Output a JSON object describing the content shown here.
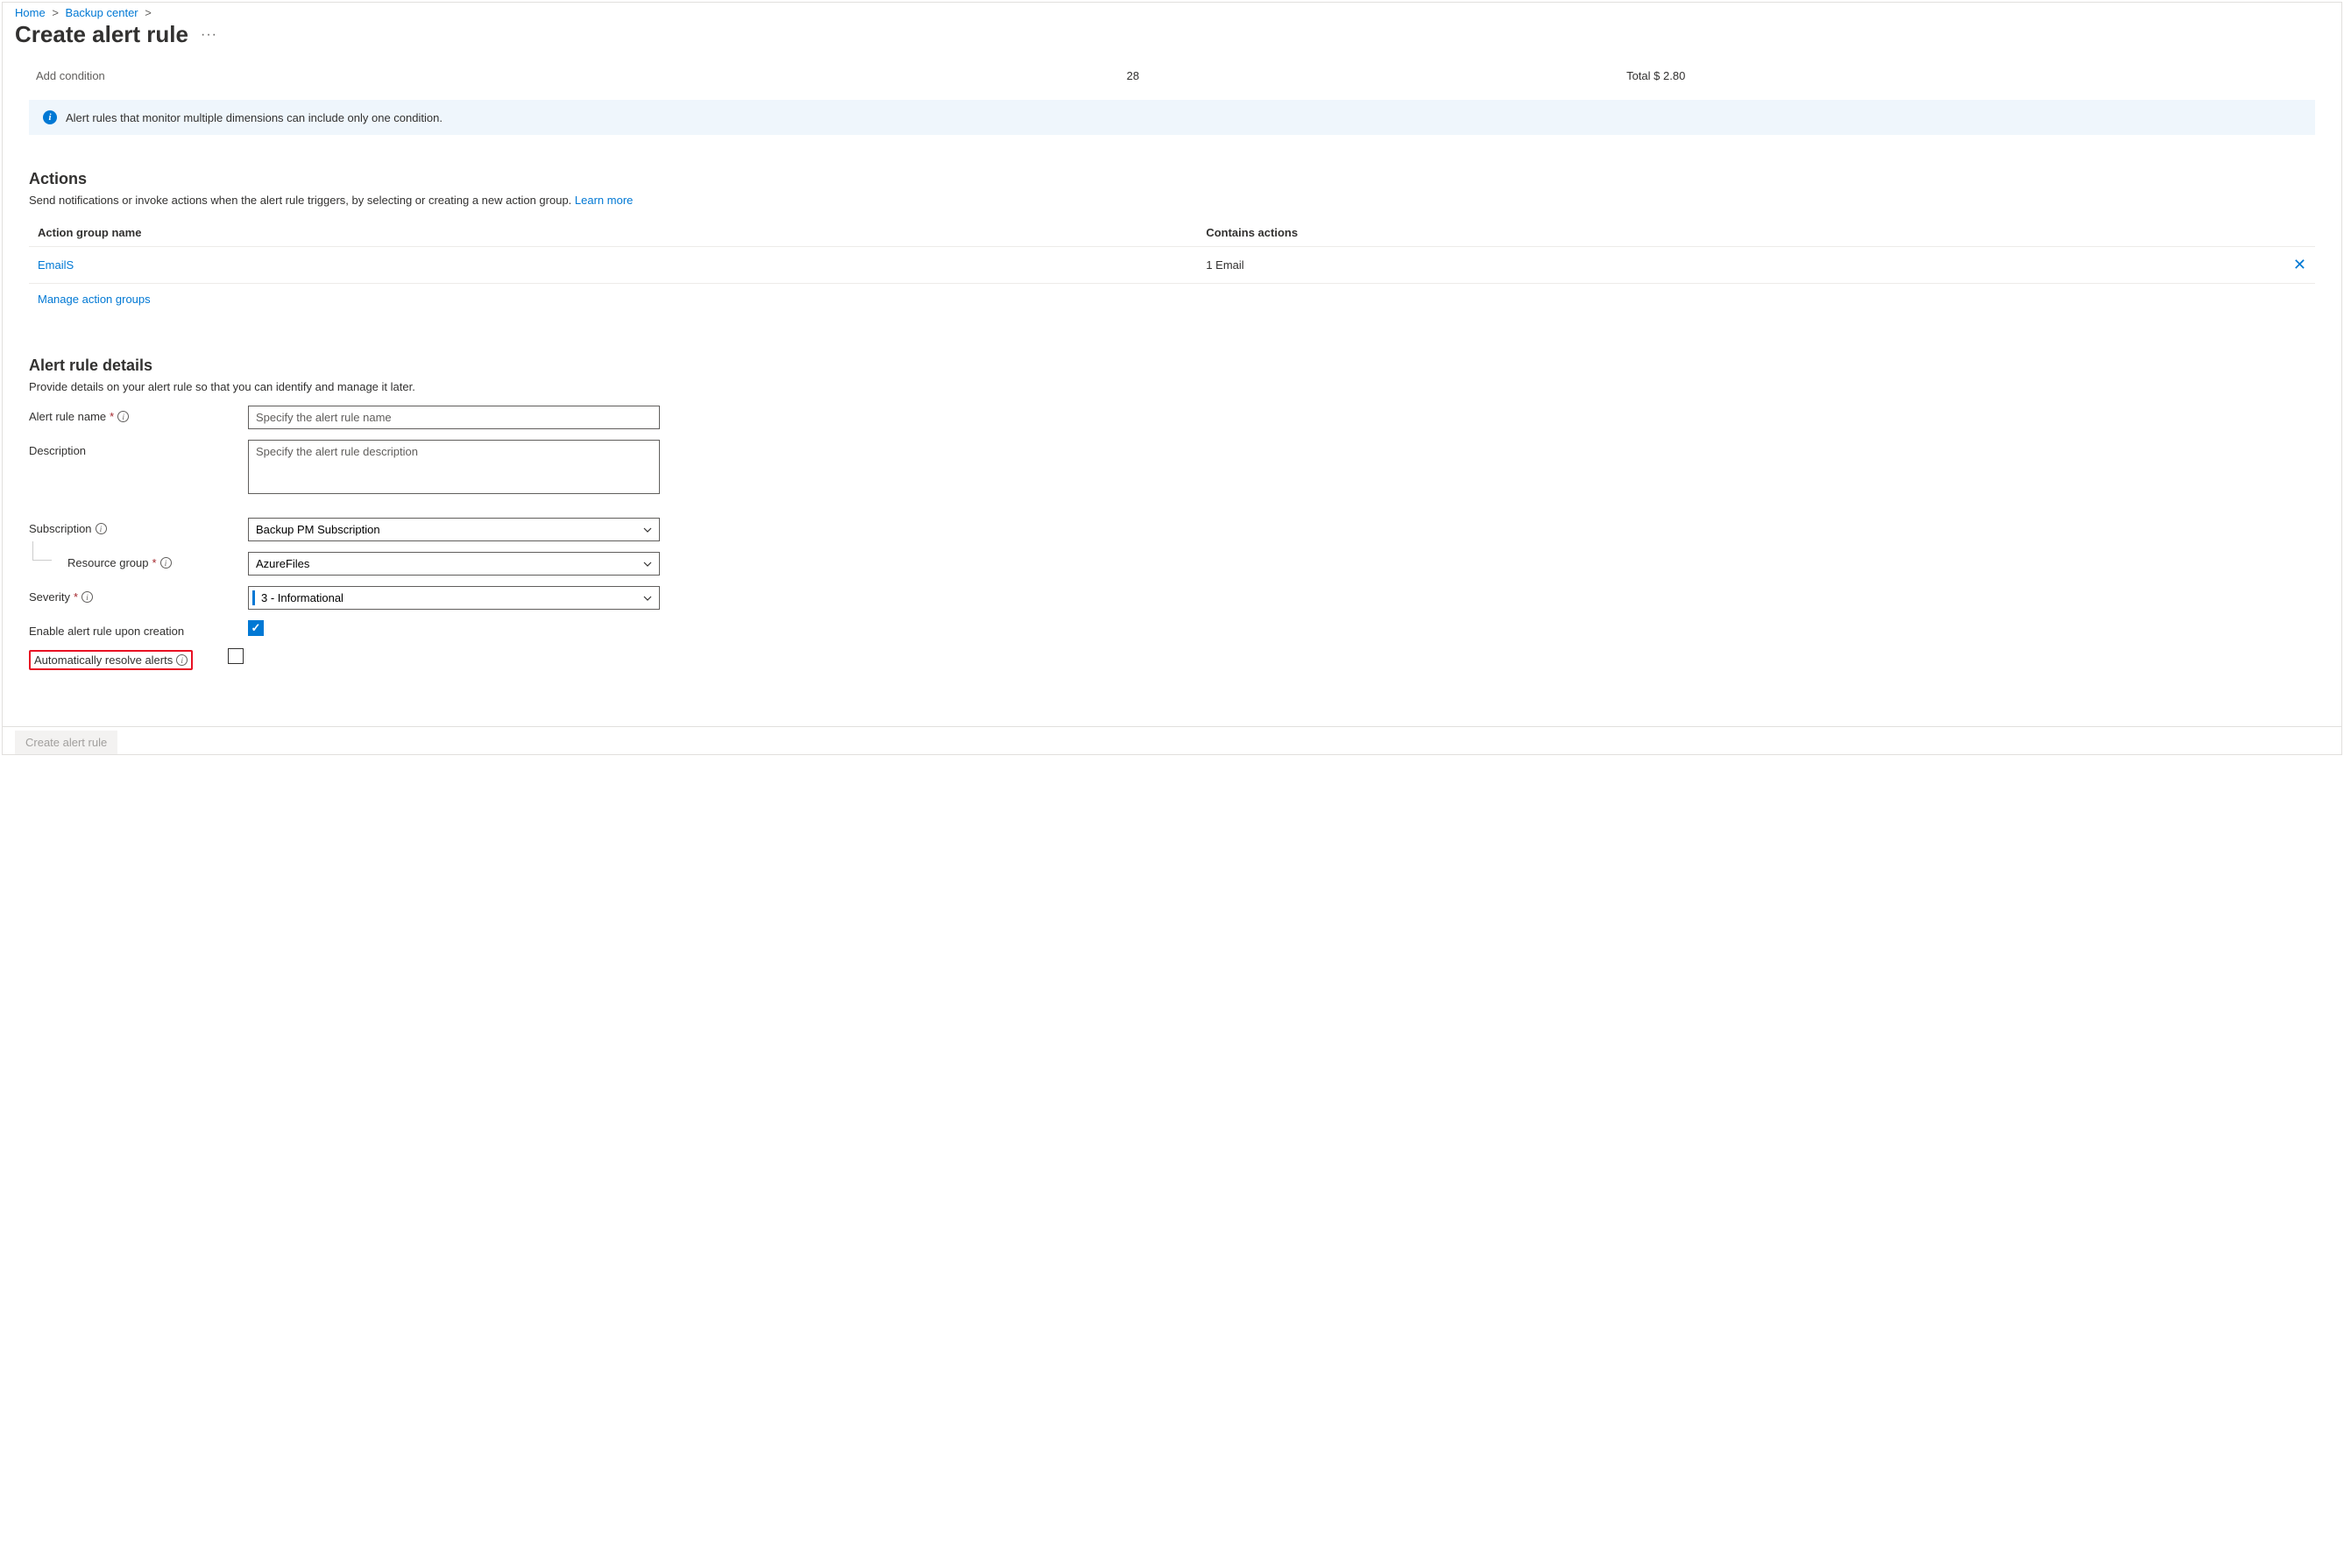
{
  "breadcrumb": {
    "home": "Home",
    "backup_center": "Backup center"
  },
  "page_title": "Create alert rule",
  "condition": {
    "add_label": "Add condition",
    "count": "28",
    "total": "Total $ 2.80"
  },
  "banner": {
    "text": "Alert rules that monitor multiple dimensions can include only one condition."
  },
  "actions": {
    "heading": "Actions",
    "desc": "Send notifications or invoke actions when the alert rule triggers, by selecting or creating a new action group. ",
    "learn_more": "Learn more",
    "col_name": "Action group name",
    "col_contains": "Contains actions",
    "rows": [
      {
        "name": "EmailS",
        "contains": "1 Email"
      }
    ],
    "manage": "Manage action groups"
  },
  "details": {
    "heading": "Alert rule details",
    "desc": "Provide details on your alert rule so that you can identify and manage it later.",
    "name_label": "Alert rule name",
    "name_placeholder": "Specify the alert rule name",
    "desc_label": "Description",
    "desc_placeholder": "Specify the alert rule description",
    "subscription_label": "Subscription",
    "subscription_value": "Backup PM Subscription",
    "rg_label": "Resource group",
    "rg_value": "AzureFiles",
    "severity_label": "Severity",
    "severity_value": "3 - Informational",
    "enable_label": "Enable alert rule upon creation",
    "auto_resolve_label": "Automatically resolve alerts"
  },
  "footer": {
    "create": "Create alert rule"
  }
}
